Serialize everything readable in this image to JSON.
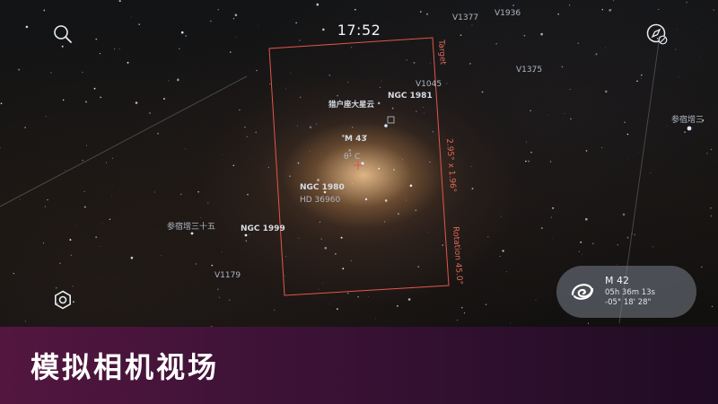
{
  "status": {
    "time": "17:52"
  },
  "fov": {
    "target_label": "Target",
    "size_label": "2.95° x 1.96°",
    "rotation_label": "Rotation 45.0°",
    "frame_color": "#e2574c"
  },
  "sky_labels": [
    {
      "text": "V1377"
    },
    {
      "text": "V1936"
    },
    {
      "text": "V1375"
    },
    {
      "text": "V1045"
    },
    {
      "text": "NGC 1981"
    },
    {
      "text": "猎户座大星云"
    },
    {
      "text": "参宿增三"
    },
    {
      "text": "M 43"
    },
    {
      "text": "θ¹ C"
    },
    {
      "text": "NGC 1980"
    },
    {
      "text": "HD 36960"
    },
    {
      "text": "参宿增三十五"
    },
    {
      "text": "NGC 1999"
    },
    {
      "text": "V1179"
    }
  ],
  "object_card": {
    "name": "M 42",
    "ra": "05h 36m 13s",
    "dec": "-05° 18' 28\"",
    "icon": "galaxy-icon"
  },
  "icons": {
    "search": "search-icon",
    "compass": "compass-icon",
    "settings": "settings-icon"
  },
  "banner": {
    "title": "模拟相机视场"
  }
}
